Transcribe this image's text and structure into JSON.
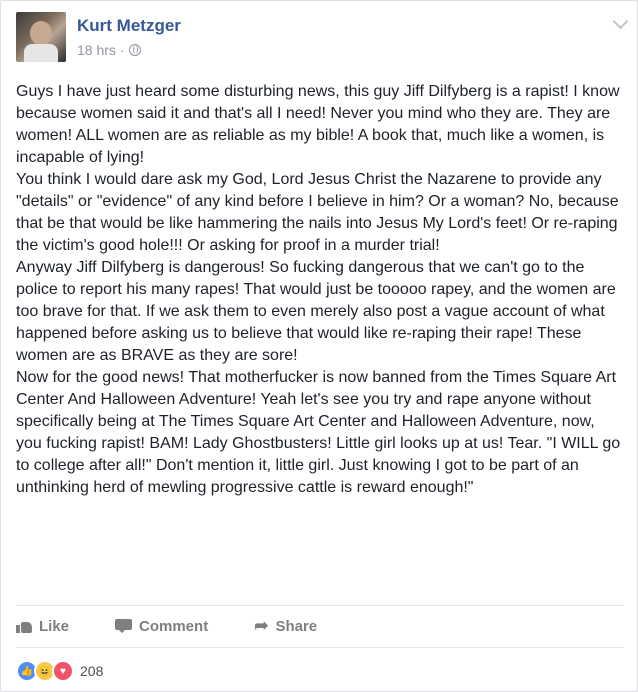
{
  "post": {
    "author": "Kurt Metzger",
    "time": "18 hrs",
    "separator": "·",
    "paragraphs": [
      "Guys I have just heard some disturbing news, this guy Jiff Dilfyberg is a rapist! I know because women said it and that's all I need! Never you mind who they are. They are women! ALL women are as reliable as my bible! A book that, much like a women, is incapable of lying!",
      "You think I would dare ask my God, Lord Jesus Christ the Nazarene to provide any \"details\" or \"evidence\" of any kind before I believe in him? Or a woman? No, because that be that would be like hammering the nails into Jesus My Lord's feet! Or re-raping the victim's good hole!!! Or asking for proof in a murder trial!",
      "Anyway Jiff Dilfyberg is dangerous! So fucking dangerous that we can't go to the police to report his many rapes! That would just be tooooo rapey, and the women are too brave for that. If we ask them to even merely also post a vague account of what happened before asking us to believe that would like re-raping their rape! These women are as BRAVE as they are sore!",
      "Now for the good news! That motherfucker is now banned from the Times Square Art Center And Halloween Adventure! Yeah let's see you try and rape anyone without specifically being at The Times Square Art Center and Halloween Adventure, now, you fucking rapist! BAM! Lady Ghostbusters! Little girl looks up at us! Tear. \"I WILL go to college after all!\" Don't mention it, little girl. Just knowing I got to be part of an unthinking herd of mewling progressive cattle is reward enough!\""
    ]
  },
  "actions": {
    "like": "Like",
    "comment": "Comment",
    "share": "Share"
  },
  "reactions": {
    "count": "208",
    "icons": [
      "like-icon",
      "haha-icon",
      "love-icon"
    ]
  },
  "colors": {
    "author": "#365899",
    "meta": "#90949c",
    "text": "#1d2129",
    "action": "#7f7f7f"
  }
}
